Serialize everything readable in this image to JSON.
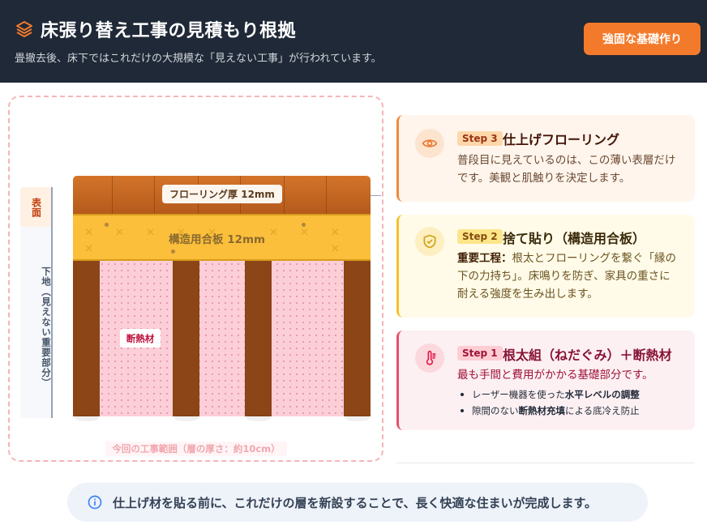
{
  "header": {
    "title": "床張り替え工事の見積もり根拠",
    "subtitle": "畳撤去後、床下ではこれだけの大規模な「見えない工事」が行われています。",
    "button": "強固な基礎作り",
    "accent": "#f47a2b",
    "icon": "layers-icon"
  },
  "diagram": {
    "side_label_top": "表面",
    "side_label_bottom": "下地（見えない重要部分）",
    "flooring_label": "フローリング厚 12mm",
    "plywood_label": "構造用合板 12mm",
    "insulation_label": "断熱材",
    "range_caption": "今回の工事範囲（層の厚さ：約10cm）"
  },
  "steps": {
    "step3": {
      "badge": "Step 3",
      "title": "仕上げフローリング",
      "body": "普段目に見えているのは、この薄い表層だけです。美観と肌触りを決定します。",
      "icon": "eye-icon"
    },
    "step2": {
      "badge": "Step 2",
      "title": "捨て貼り（構造用合板）",
      "body_strong": "重要工程：",
      "body": "根太とフローリングを繋ぐ「縁の下の力持ち」。床鳴りを防ぎ、家具の重さに耐える強度を生み出します。",
      "icon": "shield-check-icon"
    },
    "step1": {
      "badge": "Step 1",
      "title": "根太組（ねだぐみ）＋断熱材",
      "body": "最も手間と費用がかかる基礎部分です。",
      "bullets": [
        {
          "pre": "レーザー機器を使った",
          "strong": "水平レベルの調整",
          "post": ""
        },
        {
          "pre": "隙間のない",
          "strong": "断熱材充填",
          "post": "による底冷え防止"
        }
      ],
      "icon": "thermometer-icon"
    }
  },
  "footer": {
    "text": "仕上げ材を貼る前に、これだけの層を新設することで、長く快適な住まいが完成します。",
    "icon": "info-icon"
  }
}
